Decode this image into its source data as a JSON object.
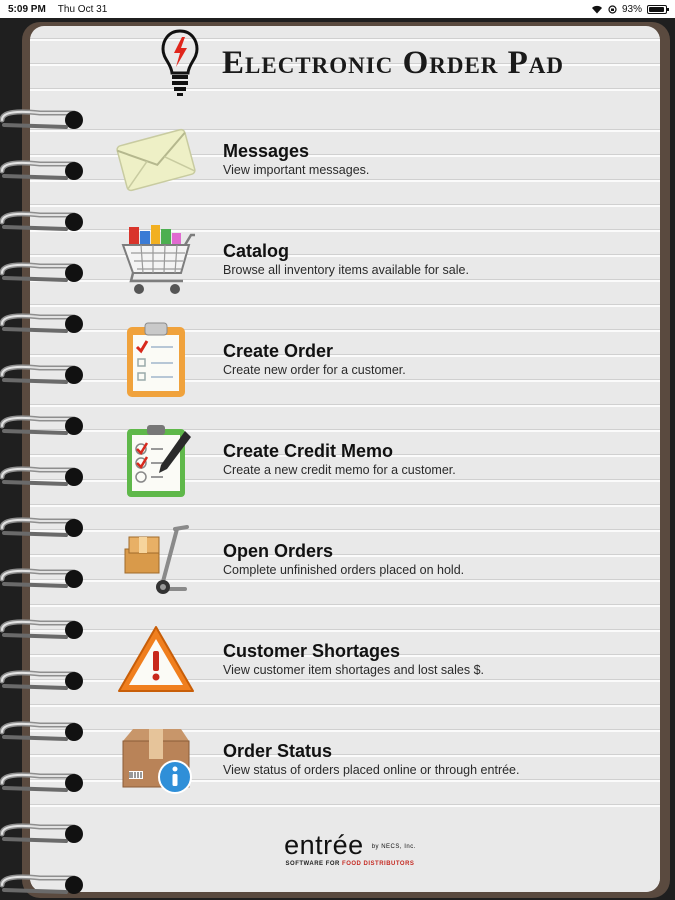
{
  "status_bar": {
    "time": "5:09 PM",
    "date": "Thu Oct 31",
    "battery_percent": "93%",
    "battery_level": 0.93
  },
  "header": {
    "title": "Electronic Order Pad",
    "logo_icon": "lightbulb-icon"
  },
  "menu": [
    {
      "id": "messages",
      "icon": "envelope-icon",
      "label": "Messages",
      "description": "View important messages."
    },
    {
      "id": "catalog",
      "icon": "shopping-cart-icon",
      "label": "Catalog",
      "description": "Browse all inventory items available for sale."
    },
    {
      "id": "create-order",
      "icon": "clipboard-icon",
      "label": "Create Order",
      "description": "Create new order for a customer."
    },
    {
      "id": "create-credit-memo",
      "icon": "checklist-pen-icon",
      "label": "Create Credit Memo",
      "description": "Create a new credit memo for a customer."
    },
    {
      "id": "open-orders",
      "icon": "hand-truck-icon",
      "label": "Open Orders",
      "description": "Complete unfinished orders placed on hold."
    },
    {
      "id": "customer-shortages",
      "icon": "warning-icon",
      "label": "Customer Shortages",
      "description": "View customer item shortages and lost sales $."
    },
    {
      "id": "order-status",
      "icon": "package-info-icon",
      "label": "Order Status",
      "description": "View status of orders placed online or through entrée."
    }
  ],
  "footer": {
    "brand": "entrée",
    "by": "by NECS, Inc.",
    "tagline_prefix": "SOFTWARE FOR ",
    "tagline_highlight": "FOOD DISTRIBUTORS"
  },
  "colors": {
    "pad_brown": "#5a4a3f",
    "paper": "#e9e9e9",
    "accent_red": "#c52a22"
  }
}
